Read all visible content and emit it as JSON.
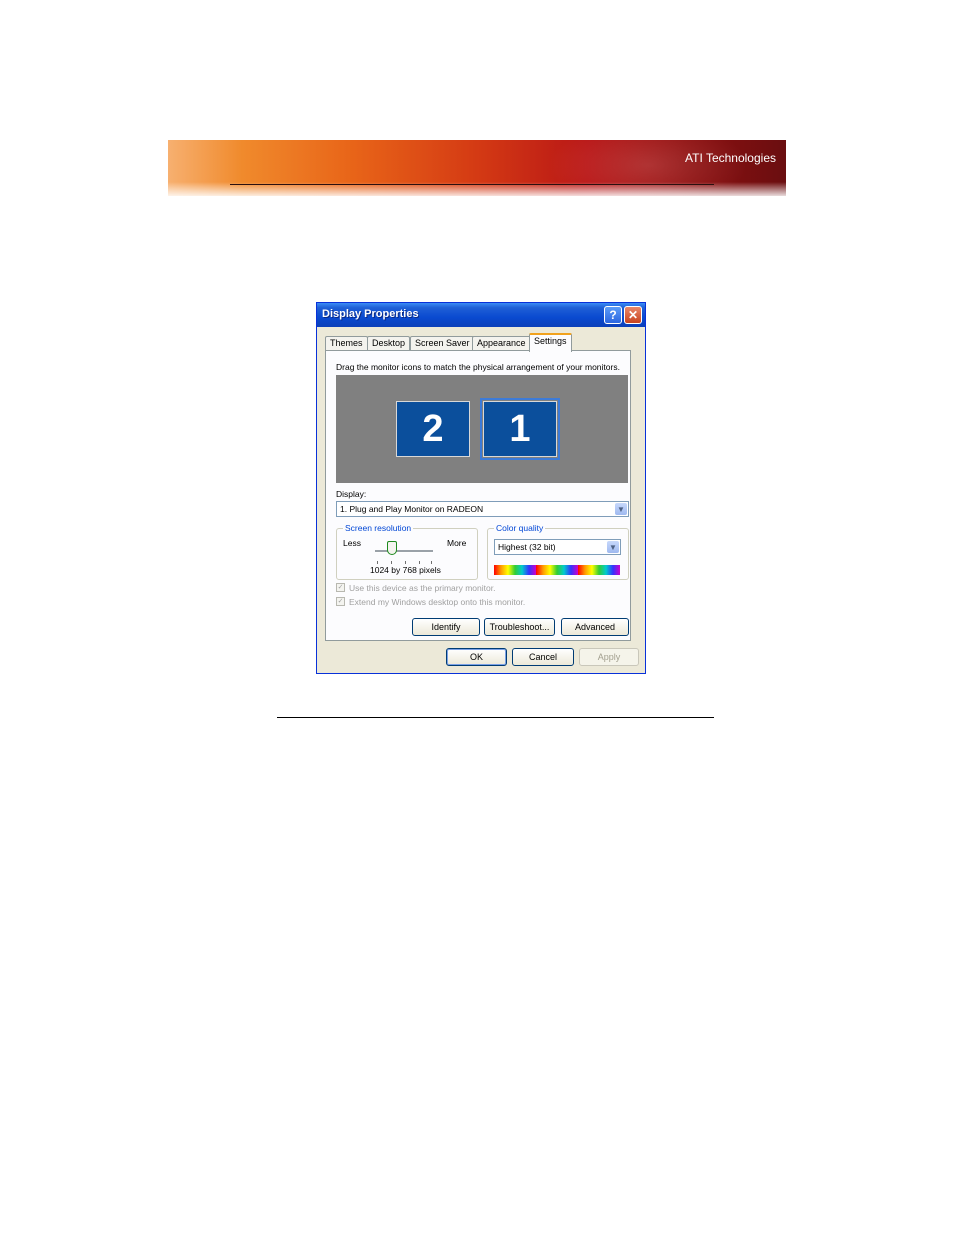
{
  "banner": {
    "brand": "ATI Technologies"
  },
  "dialog": {
    "title": "Display Properties",
    "help_glyph": "?",
    "close_glyph": "✕",
    "tabs": [
      {
        "label": "Themes"
      },
      {
        "label": "Desktop"
      },
      {
        "label": "Screen Saver"
      },
      {
        "label": "Appearance"
      },
      {
        "label": "Settings",
        "active": true
      }
    ],
    "instructions": "Drag the monitor icons to match the physical arrangement of your monitors.",
    "monitors": [
      {
        "number": "2"
      },
      {
        "number": "1",
        "selected": true
      }
    ],
    "display_label": "Display:",
    "display_value": "1. Plug and Play Monitor on RADEON",
    "screen_resolution": {
      "title": "Screen resolution",
      "less": "Less",
      "more": "More",
      "value_text": "1024 by 768 pixels"
    },
    "color_quality": {
      "title": "Color quality",
      "value": "Highest (32 bit)"
    },
    "checkboxes": [
      {
        "label": "Use this device as the primary monitor.",
        "checked": true,
        "disabled": true
      },
      {
        "label": "Extend my Windows desktop onto this monitor.",
        "checked": true,
        "disabled": true
      }
    ],
    "check_glyph": "✓",
    "dropdown_glyph": "▼",
    "buttons": {
      "identify": "Identify",
      "troubleshoot": "Troubleshoot...",
      "advanced": "Advanced",
      "ok": "OK",
      "cancel": "Cancel",
      "apply": "Apply"
    }
  }
}
